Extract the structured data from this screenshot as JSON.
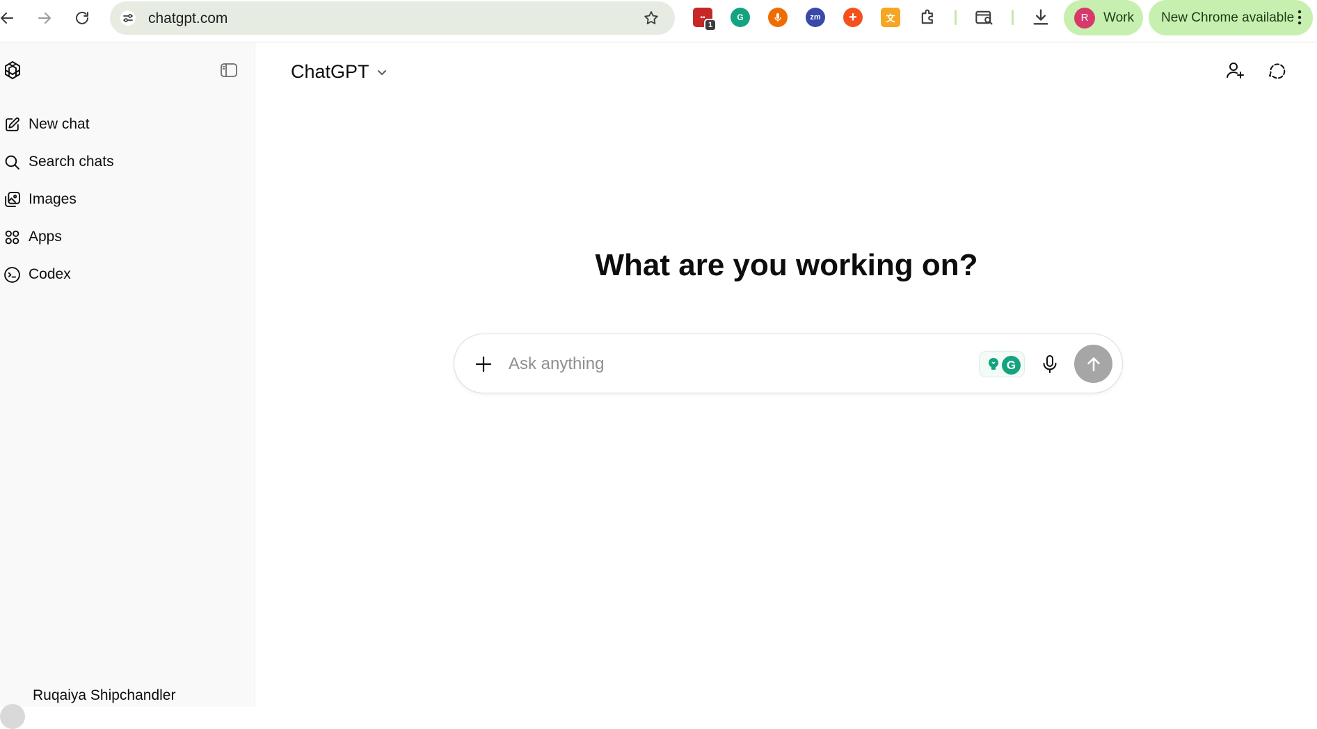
{
  "browser": {
    "url": "chatgpt.com",
    "profile_initial": "R",
    "profile_label": "Work",
    "update_label": "New Chrome available",
    "extension_badge": "1",
    "extensions": [
      "calendar-extension-icon",
      "grammarly-extension-icon",
      "voice-extension-icon",
      "zoom-extension-icon",
      "plus-extension-icon",
      "translate-extension-icon",
      "extensions-puzzle-icon"
    ]
  },
  "sidebar": {
    "items": [
      {
        "label": "New chat",
        "icon": "edit-icon"
      },
      {
        "label": "Search chats",
        "icon": "search-icon"
      },
      {
        "label": "Images",
        "icon": "images-icon"
      },
      {
        "label": "Apps",
        "icon": "apps-icon"
      },
      {
        "label": "Codex",
        "icon": "codex-icon"
      }
    ],
    "user_name": "Ruqaiya Shipchandler"
  },
  "main": {
    "model_name": "ChatGPT",
    "heading": "What are you working on?",
    "composer": {
      "placeholder": "Ask anything",
      "value": ""
    }
  },
  "colors": {
    "pill_green": "#c7f0b0",
    "omnibox_bg": "#e6ece1",
    "send_disabled": "#a6a6a6",
    "profile_avatar": "#d6396a"
  }
}
